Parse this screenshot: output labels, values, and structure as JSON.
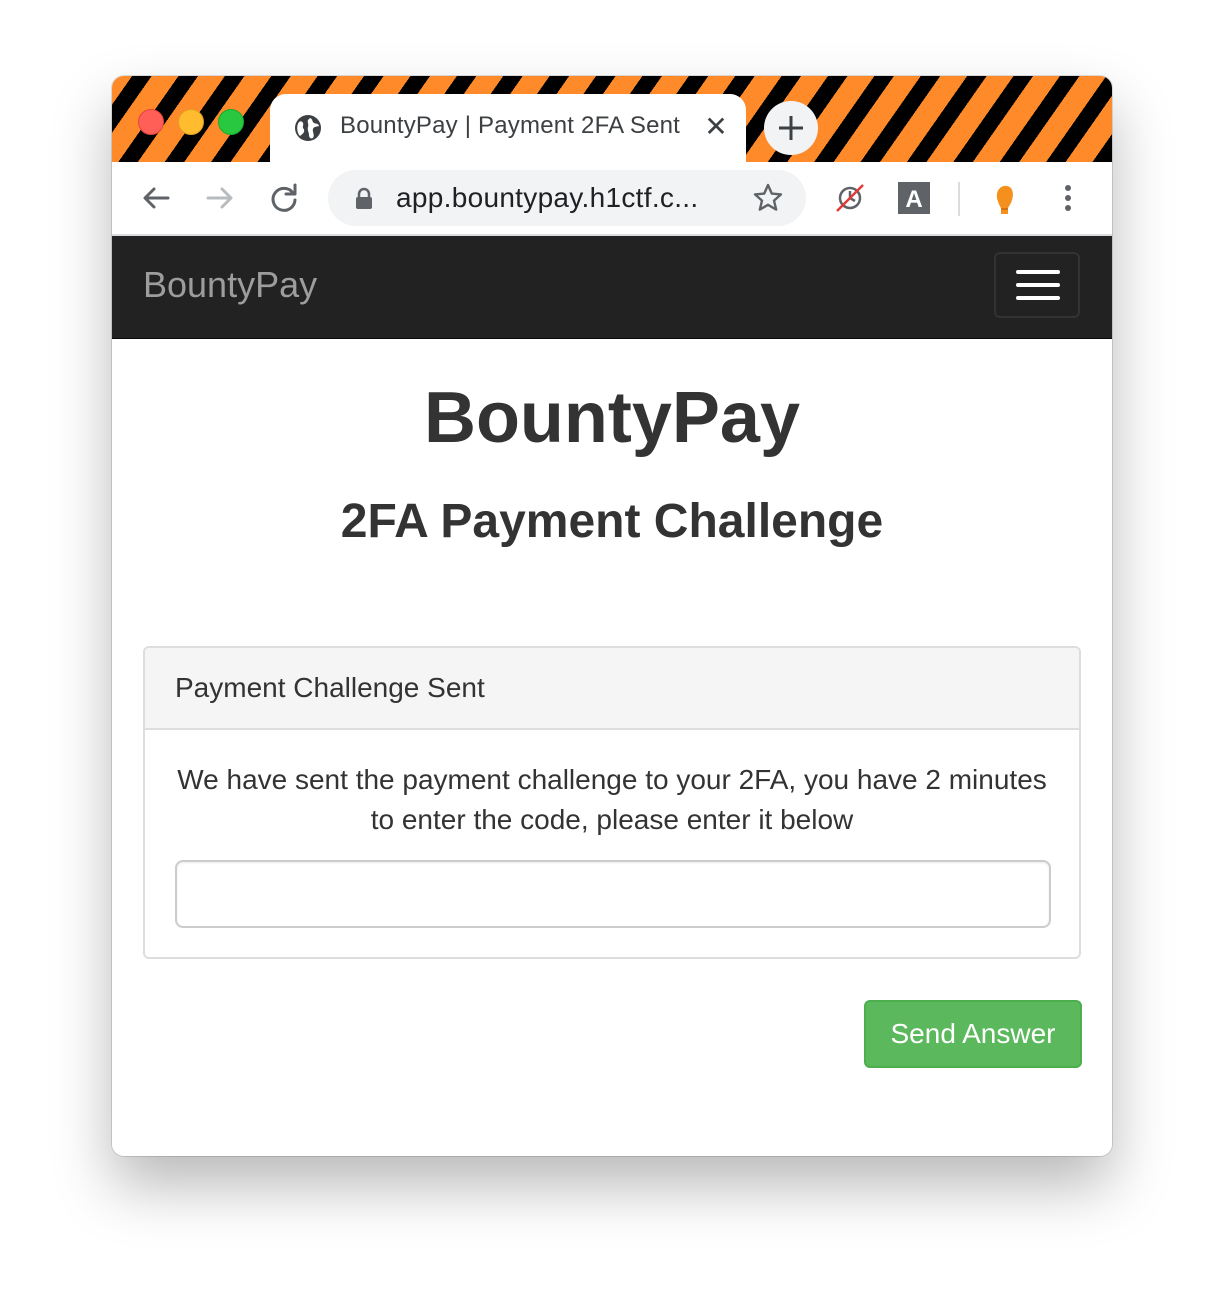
{
  "browser": {
    "tab": {
      "title": "BountyPay | Payment 2FA Sent",
      "close_symbol": "✕",
      "icon": "globe-icon"
    },
    "toolbar": {
      "back_icon": "back-arrow-icon",
      "forward_icon": "forward-arrow-icon",
      "reload_icon": "reload-icon",
      "url": "app.bountypay.h1ctf.c...",
      "lock_icon": "lock-icon",
      "bookmark_icon": "star-icon",
      "extensions": [
        "tracking-blocked-icon",
        "translate-icon",
        "profile-head-icon"
      ],
      "extension_letter": "A",
      "menu_icon": "kebab-menu-icon"
    },
    "accent_colors": {
      "stripe_orange": "#ff8a2a",
      "stripe_black": "#000000"
    }
  },
  "navbar": {
    "brand": "BountyPay",
    "toggle_icon": "hamburger-icon",
    "background": "#222222"
  },
  "main": {
    "title": "BountyPay",
    "subtitle": "2FA Payment Challenge",
    "panel": {
      "heading": "Payment Challenge Sent",
      "message": "We have sent the payment challenge to your 2FA, you have 2 minutes to enter the code, please enter it below",
      "input_value": "",
      "input_placeholder": ""
    },
    "submit_label": "Send Answer",
    "submit_color": "#5cb85c"
  }
}
